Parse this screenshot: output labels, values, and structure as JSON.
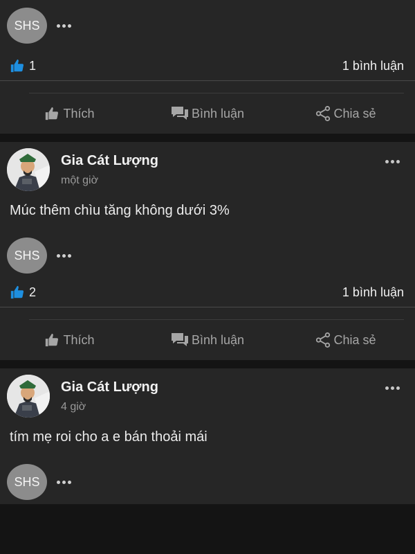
{
  "common": {
    "shs_label": "SHS",
    "like_label": "Thích",
    "comment_label": "Bình luận",
    "share_label": "Chia sẻ"
  },
  "colors": {
    "like_icon": "#1e8fe0"
  },
  "top_post": {
    "likes": "1",
    "comments": "1 bình luận"
  },
  "posts": [
    {
      "author": "Gia Cát Lượng",
      "time": "một giờ",
      "text": "Múc thêm chìu tăng không dưới 3%",
      "likes": "2",
      "comments": "1 bình luận"
    },
    {
      "author": "Gia Cát Lượng",
      "time": "4 giờ",
      "text": "tím mẹ roi cho a e bán thoải mái"
    }
  ]
}
